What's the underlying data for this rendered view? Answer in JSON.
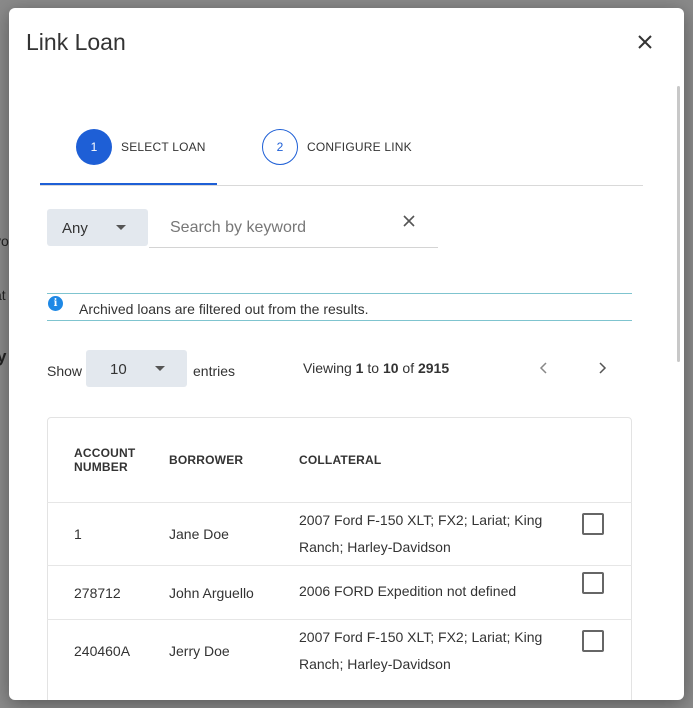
{
  "backdrop": {
    "fragments": [
      "yo",
      "at",
      "y"
    ]
  },
  "modal": {
    "title": "Link Loan"
  },
  "steps": [
    {
      "number": "1",
      "label": "SELECT LOAN",
      "active": true
    },
    {
      "number": "2",
      "label": "CONFIGURE LINK",
      "active": false
    }
  ],
  "filter": {
    "type_value": "Any",
    "search_placeholder": "Search by keyword",
    "search_value": ""
  },
  "info": {
    "text": "Archived loans are filtered out from the results."
  },
  "pagination": {
    "show_label": "Show",
    "page_size": "10",
    "entries_label": "entries",
    "viewing_prefix": "Viewing",
    "from": "1",
    "to_word": "to",
    "to": "10",
    "of_word": "of",
    "total": "2915"
  },
  "table": {
    "headers": {
      "account_line1": "ACCOUNT",
      "account_line2": "NUMBER",
      "borrower": "BORROWER",
      "collateral": "COLLATERAL"
    },
    "rows": [
      {
        "account": "1",
        "borrower": "Jane Doe",
        "collateral": "2007 Ford F-150 XLT; FX2; Lariat; King Ranch; Harley-Davidson",
        "selected": false
      },
      {
        "account": "278712",
        "borrower": "John Arguello",
        "collateral": "2006 FORD Expedition not defined",
        "selected": false
      },
      {
        "account": "240460A",
        "borrower": "Jerry Doe",
        "collateral": "2007 Ford F-150 XLT; FX2; Lariat; King Ranch; Harley-Davidson",
        "selected": false
      }
    ]
  },
  "colors": {
    "accent": "#1e5fd6",
    "select_bg": "#e3e8ee",
    "info_border": "#7fc4cf",
    "info_icon": "#1e88e5"
  }
}
